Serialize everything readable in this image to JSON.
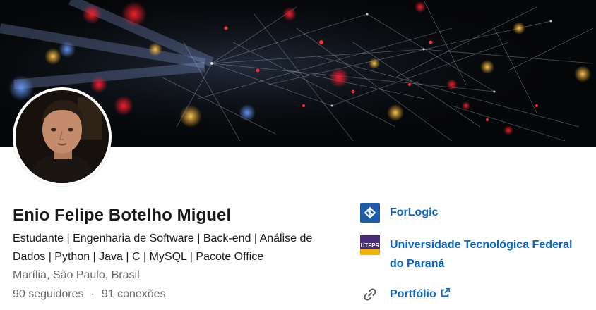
{
  "profile": {
    "name": "Enio Felipe Botelho Miguel",
    "headline": "Estudante | Engenharia de Software | Back-end | Análise de Dados | Python | Java | C | MySQL | Pacote Office",
    "location": "Marília, São Paulo, Brasil",
    "followers": "90 seguidores",
    "separator": "·",
    "connections": "91 conexões"
  },
  "links": {
    "company": {
      "label": "ForLogic",
      "icon": "forlogic-logo"
    },
    "education": {
      "label_line1": "Universidade Tecnológica Federal",
      "label_line2": "do Paraná",
      "icon": "utfpr-logo",
      "logo_text": "UTFPR"
    },
    "portfolio": {
      "label": "Portfólio",
      "icon": "link-icon",
      "external_icon": "external-link-icon"
    }
  },
  "colors": {
    "link": "#0a66c2",
    "banner_bg": "#050608",
    "forlogic": "#1d5aa8",
    "utfpr": "#4a2a7a"
  }
}
